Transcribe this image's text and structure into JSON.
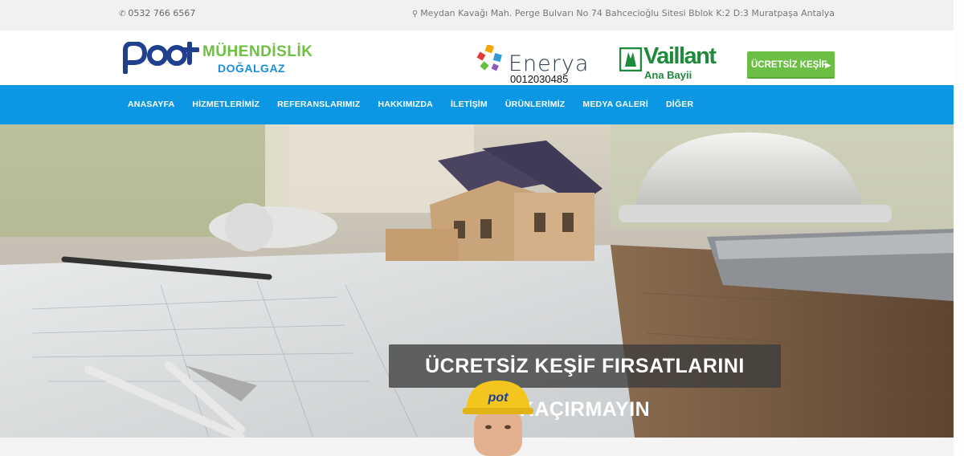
{
  "topbar": {
    "phone": "0532 766 6567",
    "address": "Meydan Kavağı Mah. Perge Bulvarı No 74 Bahcecioğlu Sitesi Bblok K:2 D:3 Muratpaşa Antalya"
  },
  "logo": {
    "line1": "MÜHENDİSLİK",
    "line2": "DOĞALGAZ",
    "mark_text": "pot"
  },
  "partners": {
    "enerya_name": "Enerya",
    "enerya_number": "0012030485",
    "vaillant_name": "Vaillant",
    "vaillant_sub": "Ana Bayii"
  },
  "cta": {
    "label": "ÜCRETSİZ KEŞİF"
  },
  "nav": {
    "items": [
      "ANASAYFA",
      "HİZMETLERİMİZ",
      "REFERANSLARIMIZ",
      "HAKKIMIZDA",
      "İLETİŞİM",
      "ÜRÜNLERİMİZ",
      "MEDYA GALERİ",
      "DİĞER"
    ]
  },
  "hero": {
    "banner_text": "ÜCRETSİZ KEŞİF FIRSATLARINI KAÇIRMAYIN"
  },
  "colors": {
    "nav_blue": "#0b97e3",
    "cta_green": "#6bbf45",
    "logo_green": "#6fbf44",
    "logo_blue": "#1a8fd6",
    "vaillant_green": "#1e8a3c"
  }
}
